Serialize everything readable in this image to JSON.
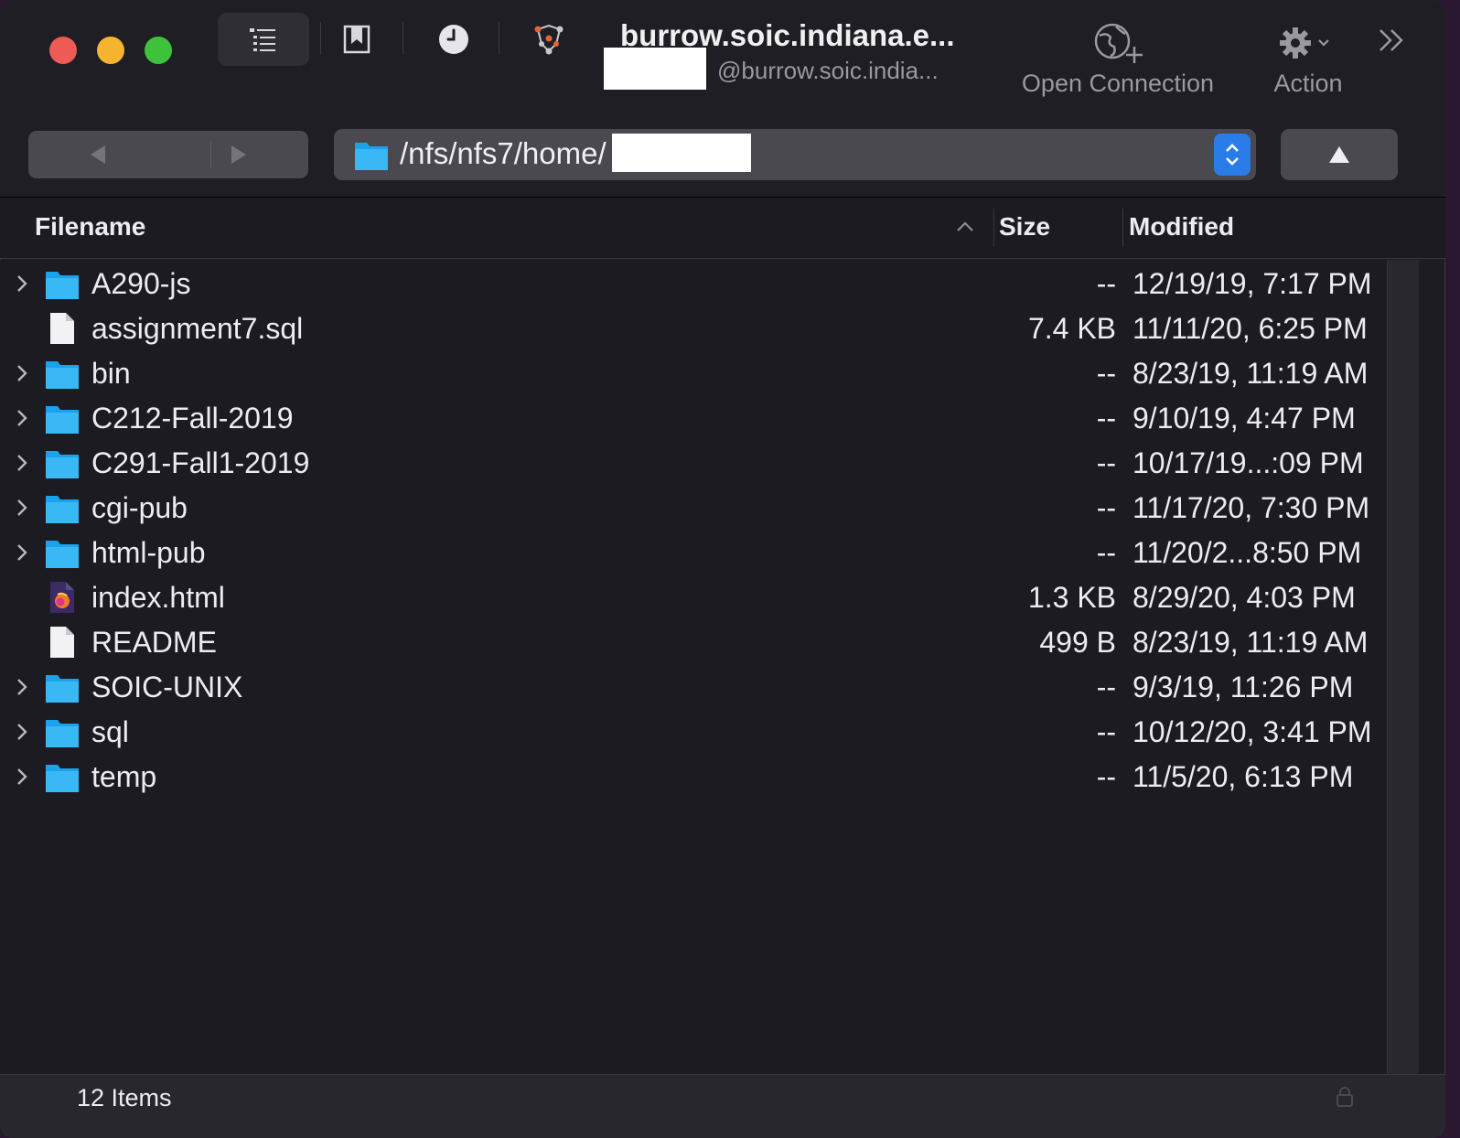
{
  "toolbar": {
    "connection_title": "burrow.soic.indiana.e...",
    "connection_user": "@burrow.soic.india...",
    "open_connection_label": "Open Connection",
    "action_label": "Action",
    "icons": [
      "outline-view-icon",
      "bookmarks-icon",
      "history-icon",
      "bonjour-icon",
      "open-connection-globe-icon",
      "gear-icon",
      "overflow-chevron-icon"
    ]
  },
  "navigation": {
    "path": "/nfs/nfs7/home/",
    "back_icon": "back-arrow-icon",
    "forward_icon": "forward-arrow-icon",
    "up_icon": "parent-directory-icon"
  },
  "columns": {
    "filename": "Filename",
    "size": "Size",
    "modified": "Modified",
    "sort": "ascending"
  },
  "files": [
    {
      "name": "A290-js",
      "size": "--",
      "modified": "12/19/19, 7:17 PM",
      "type": "folder"
    },
    {
      "name": "assignment7.sql",
      "size": "7.4 KB",
      "modified": "11/11/20, 6:25 PM",
      "type": "file"
    },
    {
      "name": "bin",
      "size": "--",
      "modified": "8/23/19, 11:19 AM",
      "type": "folder"
    },
    {
      "name": "C212-Fall-2019",
      "size": "--",
      "modified": "9/10/19, 4:47 PM",
      "type": "folder"
    },
    {
      "name": "C291-Fall1-2019",
      "size": "--",
      "modified": "10/17/19...:09 PM",
      "type": "folder"
    },
    {
      "name": "cgi-pub",
      "size": "--",
      "modified": "11/17/20, 7:30 PM",
      "type": "folder"
    },
    {
      "name": "html-pub",
      "size": "--",
      "modified": "11/20/2...8:50 PM",
      "type": "folder"
    },
    {
      "name": "index.html",
      "size": "1.3 KB",
      "modified": "8/29/20, 4:03 PM",
      "type": "html"
    },
    {
      "name": "README",
      "size": "499 B",
      "modified": "8/23/19, 11:19 AM",
      "type": "file"
    },
    {
      "name": "SOIC-UNIX",
      "size": "--",
      "modified": "9/3/19, 11:26 PM",
      "type": "folder"
    },
    {
      "name": "sql",
      "size": "--",
      "modified": "10/12/20, 3:41 PM",
      "type": "folder"
    },
    {
      "name": "temp",
      "size": "--",
      "modified": "11/5/20, 6:13 PM",
      "type": "folder"
    }
  ],
  "status": {
    "item_count": "12 Items"
  },
  "colors": {
    "window_bg": "#1d1c22",
    "folder_blue": "#1aa3ec",
    "accent_blue": "#2a7de8",
    "close": "#ee5b55",
    "minimize": "#f5b52f",
    "zoom": "#3fc23b"
  }
}
